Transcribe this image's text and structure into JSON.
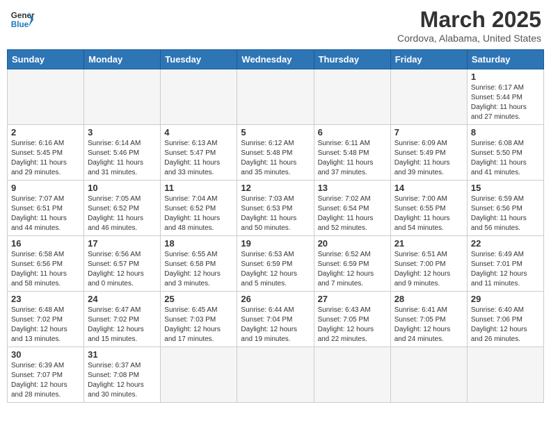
{
  "header": {
    "logo_general": "General",
    "logo_blue": "Blue",
    "main_title": "March 2025",
    "sub_title": "Cordova, Alabama, United States"
  },
  "days_of_week": [
    "Sunday",
    "Monday",
    "Tuesday",
    "Wednesday",
    "Thursday",
    "Friday",
    "Saturday"
  ],
  "weeks": [
    [
      {
        "day": "",
        "info": ""
      },
      {
        "day": "",
        "info": ""
      },
      {
        "day": "",
        "info": ""
      },
      {
        "day": "",
        "info": ""
      },
      {
        "day": "",
        "info": ""
      },
      {
        "day": "",
        "info": ""
      },
      {
        "day": "1",
        "info": "Sunrise: 6:17 AM\nSunset: 5:44 PM\nDaylight: 11 hours\nand 27 minutes."
      }
    ],
    [
      {
        "day": "2",
        "info": "Sunrise: 6:16 AM\nSunset: 5:45 PM\nDaylight: 11 hours\nand 29 minutes."
      },
      {
        "day": "3",
        "info": "Sunrise: 6:14 AM\nSunset: 5:46 PM\nDaylight: 11 hours\nand 31 minutes."
      },
      {
        "day": "4",
        "info": "Sunrise: 6:13 AM\nSunset: 5:47 PM\nDaylight: 11 hours\nand 33 minutes."
      },
      {
        "day": "5",
        "info": "Sunrise: 6:12 AM\nSunset: 5:48 PM\nDaylight: 11 hours\nand 35 minutes."
      },
      {
        "day": "6",
        "info": "Sunrise: 6:11 AM\nSunset: 5:48 PM\nDaylight: 11 hours\nand 37 minutes."
      },
      {
        "day": "7",
        "info": "Sunrise: 6:09 AM\nSunset: 5:49 PM\nDaylight: 11 hours\nand 39 minutes."
      },
      {
        "day": "8",
        "info": "Sunrise: 6:08 AM\nSunset: 5:50 PM\nDaylight: 11 hours\nand 41 minutes."
      }
    ],
    [
      {
        "day": "9",
        "info": "Sunrise: 7:07 AM\nSunset: 6:51 PM\nDaylight: 11 hours\nand 44 minutes."
      },
      {
        "day": "10",
        "info": "Sunrise: 7:05 AM\nSunset: 6:52 PM\nDaylight: 11 hours\nand 46 minutes."
      },
      {
        "day": "11",
        "info": "Sunrise: 7:04 AM\nSunset: 6:52 PM\nDaylight: 11 hours\nand 48 minutes."
      },
      {
        "day": "12",
        "info": "Sunrise: 7:03 AM\nSunset: 6:53 PM\nDaylight: 11 hours\nand 50 minutes."
      },
      {
        "day": "13",
        "info": "Sunrise: 7:02 AM\nSunset: 6:54 PM\nDaylight: 11 hours\nand 52 minutes."
      },
      {
        "day": "14",
        "info": "Sunrise: 7:00 AM\nSunset: 6:55 PM\nDaylight: 11 hours\nand 54 minutes."
      },
      {
        "day": "15",
        "info": "Sunrise: 6:59 AM\nSunset: 6:56 PM\nDaylight: 11 hours\nand 56 minutes."
      }
    ],
    [
      {
        "day": "16",
        "info": "Sunrise: 6:58 AM\nSunset: 6:56 PM\nDaylight: 11 hours\nand 58 minutes."
      },
      {
        "day": "17",
        "info": "Sunrise: 6:56 AM\nSunset: 6:57 PM\nDaylight: 12 hours\nand 0 minutes."
      },
      {
        "day": "18",
        "info": "Sunrise: 6:55 AM\nSunset: 6:58 PM\nDaylight: 12 hours\nand 3 minutes."
      },
      {
        "day": "19",
        "info": "Sunrise: 6:53 AM\nSunset: 6:59 PM\nDaylight: 12 hours\nand 5 minutes."
      },
      {
        "day": "20",
        "info": "Sunrise: 6:52 AM\nSunset: 6:59 PM\nDaylight: 12 hours\nand 7 minutes."
      },
      {
        "day": "21",
        "info": "Sunrise: 6:51 AM\nSunset: 7:00 PM\nDaylight: 12 hours\nand 9 minutes."
      },
      {
        "day": "22",
        "info": "Sunrise: 6:49 AM\nSunset: 7:01 PM\nDaylight: 12 hours\nand 11 minutes."
      }
    ],
    [
      {
        "day": "23",
        "info": "Sunrise: 6:48 AM\nSunset: 7:02 PM\nDaylight: 12 hours\nand 13 minutes."
      },
      {
        "day": "24",
        "info": "Sunrise: 6:47 AM\nSunset: 7:02 PM\nDaylight: 12 hours\nand 15 minutes."
      },
      {
        "day": "25",
        "info": "Sunrise: 6:45 AM\nSunset: 7:03 PM\nDaylight: 12 hours\nand 17 minutes."
      },
      {
        "day": "26",
        "info": "Sunrise: 6:44 AM\nSunset: 7:04 PM\nDaylight: 12 hours\nand 19 minutes."
      },
      {
        "day": "27",
        "info": "Sunrise: 6:43 AM\nSunset: 7:05 PM\nDaylight: 12 hours\nand 22 minutes."
      },
      {
        "day": "28",
        "info": "Sunrise: 6:41 AM\nSunset: 7:05 PM\nDaylight: 12 hours\nand 24 minutes."
      },
      {
        "day": "29",
        "info": "Sunrise: 6:40 AM\nSunset: 7:06 PM\nDaylight: 12 hours\nand 26 minutes."
      }
    ],
    [
      {
        "day": "30",
        "info": "Sunrise: 6:39 AM\nSunset: 7:07 PM\nDaylight: 12 hours\nand 28 minutes."
      },
      {
        "day": "31",
        "info": "Sunrise: 6:37 AM\nSunset: 7:08 PM\nDaylight: 12 hours\nand 30 minutes."
      },
      {
        "day": "",
        "info": ""
      },
      {
        "day": "",
        "info": ""
      },
      {
        "day": "",
        "info": ""
      },
      {
        "day": "",
        "info": ""
      },
      {
        "day": "",
        "info": ""
      }
    ]
  ]
}
